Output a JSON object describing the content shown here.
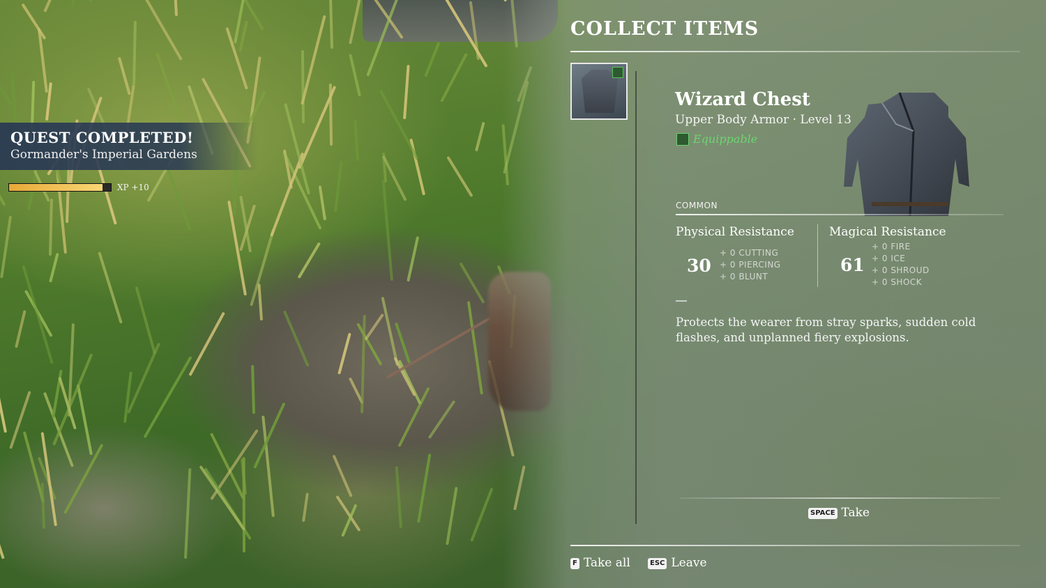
{
  "quest": {
    "title": "QUEST COMPLETED!",
    "location": "Gormander's Imperial Gardens",
    "xp_text": "XP +10",
    "xp_progress": 0.92
  },
  "panel": {
    "title": "COLLECT ITEMS"
  },
  "item": {
    "name": "Wizard Chest",
    "type_line": "Upper Body Armor  ·  Level 13",
    "equippable": "Equippable",
    "rarity": "COMMON",
    "physical": {
      "label": "Physical Resistance",
      "value": "30",
      "subs": [
        "+ 0 CUTTING",
        "+ 0 PIERCING",
        "+ 0 BLUNT"
      ]
    },
    "magical": {
      "label": "Magical Resistance",
      "value": "61",
      "subs": [
        "+ 0 FIRE",
        "+ 0 ICE",
        "+ 0 SHROUD",
        "+ 0 SHOCK"
      ]
    },
    "description": "Protects the wearer from stray sparks, sudden cold flashes, and unplanned fiery explosions."
  },
  "actions": {
    "take_key": "SPACE",
    "take_label": "Take",
    "take_all_key": "F",
    "take_all_label": "Take all",
    "leave_key": "ESC",
    "leave_label": "Leave"
  },
  "colors": {
    "accent_green": "#6cd672",
    "quest_bg": "#28384f",
    "xp_fill": "#e8a838"
  },
  "icons": {
    "slot_item": "vest-icon",
    "equippable": "armor-icon"
  }
}
